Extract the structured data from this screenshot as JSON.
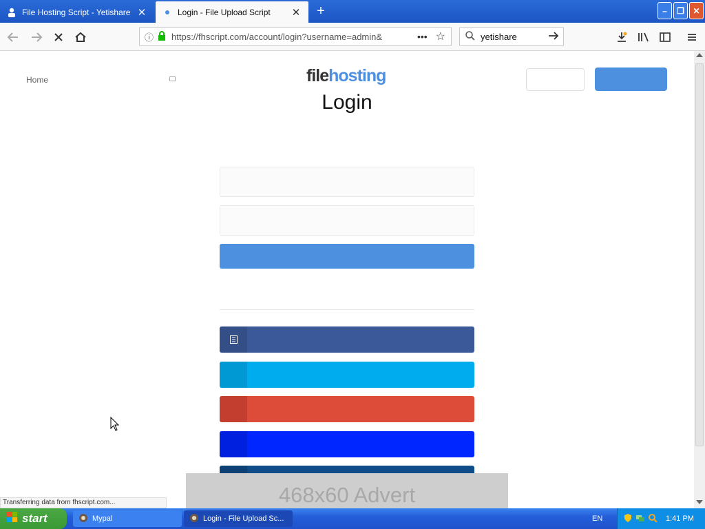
{
  "browser": {
    "tabs": [
      {
        "label": "File Hosting Script - Yetishare",
        "active": false
      },
      {
        "label": "Login - File Upload Script",
        "active": true
      }
    ],
    "url": "https://fhscript.com/account/login?username=admin&",
    "search_value": "yetishare"
  },
  "page": {
    "nav_home": "Home",
    "logo_part1": "file",
    "logo_part2": "hosting",
    "title": "Login",
    "advert": "468x60 Advert"
  },
  "status_text": "Transferring data from fhscript.com...",
  "taskbar": {
    "start_label": "start",
    "items": [
      "Mypal",
      "Login - File Upload Sc..."
    ],
    "language": "EN",
    "time": "1:41 PM"
  },
  "colors": {
    "accent": "#4d90e0",
    "facebook": "#3b5998",
    "twitter": "#00aced",
    "google": "#dd4b39",
    "blue": "#0026ff",
    "dark_blue": "#0f4d8a"
  }
}
